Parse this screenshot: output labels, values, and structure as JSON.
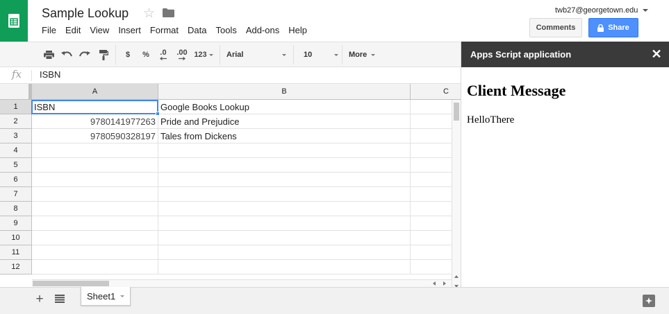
{
  "header": {
    "title": "Sample Lookup",
    "menu": [
      "File",
      "Edit",
      "View",
      "Insert",
      "Format",
      "Data",
      "Tools",
      "Add-ons",
      "Help"
    ],
    "user": "twb27@georgetown.edu",
    "comments_label": "Comments",
    "share_label": "Share"
  },
  "toolbar": {
    "currency": "$",
    "percent": "%",
    "decrease_decimals": ".0",
    "increase_decimals": ".00",
    "more_formats": "123",
    "font": "Arial",
    "font_size": "10",
    "more": "More"
  },
  "formula_bar": {
    "fx": "fx",
    "value": "ISBN"
  },
  "grid": {
    "columns": [
      "A",
      "B",
      "C"
    ],
    "rows": [
      "1",
      "2",
      "3",
      "4",
      "5",
      "6",
      "7",
      "8",
      "9",
      "10",
      "11",
      "12"
    ],
    "cells": [
      [
        "ISBN",
        "Google Books Lookup"
      ],
      [
        "9780141977263",
        "Pride and Prejudice"
      ],
      [
        "9780590328197",
        "Tales from Dickens"
      ]
    ]
  },
  "sidebar": {
    "title": "Apps Script application",
    "close": "✕",
    "heading": "Client Message",
    "message": "HelloThere"
  },
  "sheets": {
    "add": "+",
    "tabs": [
      "Sheet1"
    ]
  },
  "colors": {
    "brand_green": "#0f9d58",
    "share_blue": "#4d90fe",
    "selection_blue": "#4285f4",
    "sidebar_header": "#3a3a3a"
  },
  "icons": {
    "logo": "sheets-logo-icon",
    "star": "star-icon",
    "folder": "folder-icon",
    "print": "print-icon",
    "undo": "undo-icon",
    "redo": "redo-icon",
    "paint_format": "paint-format-icon",
    "lock": "lock-icon",
    "close": "close-icon",
    "explore": "explore-icon",
    "sheet_list": "sheet-list-icon"
  }
}
